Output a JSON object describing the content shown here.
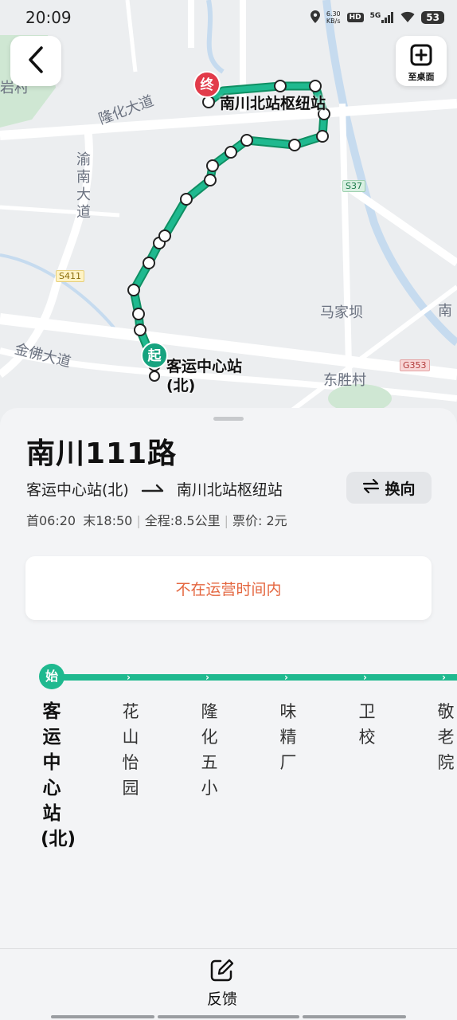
{
  "status_bar": {
    "time": "20:09",
    "net_speed_value": "6.30",
    "net_speed_unit": "KB/s",
    "hd": "HD",
    "network": "5G",
    "battery": "53"
  },
  "map": {
    "desk_button_label": "至桌面",
    "labels": {
      "yan_village": "岩村",
      "longhua_road": "隆化大道",
      "yunan_road": "渝南大道",
      "majiaba": "马家坝",
      "dongsheng_village": "东胜村",
      "jinfo_road": "金佛大道",
      "nan": "南"
    },
    "road_badges": {
      "s37": "S37",
      "s411": "S411",
      "g353": "G353"
    },
    "start_marker": "起",
    "end_marker": "终",
    "start_station": "客运中心站(北)",
    "end_station": "南川北站枢纽站",
    "colors": {
      "route": "#1fb98f",
      "end_marker": "#e23b4a",
      "start_marker": "#16a37f"
    }
  },
  "route": {
    "title": "南川111路",
    "from": "客运中心站(北)",
    "to": "南川北站枢纽站",
    "swap_label": "换向",
    "first_bus": "首06:20",
    "last_bus": "末18:50",
    "distance": "全程:8.5公里",
    "fare": "票价: 2元",
    "notice": "不在运营时间内",
    "start_badge": "始",
    "stops": [
      "客运中心站(北)",
      "花山怡园",
      "隆化五小",
      "味精厂",
      "卫校",
      "敬老院"
    ]
  },
  "footer": {
    "feedback_label": "反馈"
  }
}
